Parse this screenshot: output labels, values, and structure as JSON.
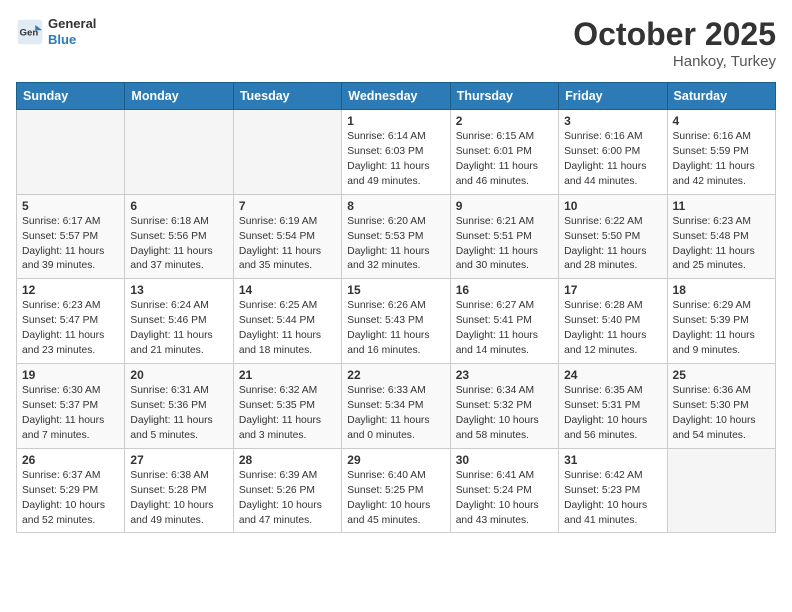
{
  "logo": {
    "line1": "General",
    "line2": "Blue"
  },
  "title": "October 2025",
  "subtitle": "Hankoy, Turkey",
  "weekdays": [
    "Sunday",
    "Monday",
    "Tuesday",
    "Wednesday",
    "Thursday",
    "Friday",
    "Saturday"
  ],
  "weeks": [
    [
      {
        "day": "",
        "info": ""
      },
      {
        "day": "",
        "info": ""
      },
      {
        "day": "",
        "info": ""
      },
      {
        "day": "1",
        "info": "Sunrise: 6:14 AM\nSunset: 6:03 PM\nDaylight: 11 hours\nand 49 minutes."
      },
      {
        "day": "2",
        "info": "Sunrise: 6:15 AM\nSunset: 6:01 PM\nDaylight: 11 hours\nand 46 minutes."
      },
      {
        "day": "3",
        "info": "Sunrise: 6:16 AM\nSunset: 6:00 PM\nDaylight: 11 hours\nand 44 minutes."
      },
      {
        "day": "4",
        "info": "Sunrise: 6:16 AM\nSunset: 5:59 PM\nDaylight: 11 hours\nand 42 minutes."
      }
    ],
    [
      {
        "day": "5",
        "info": "Sunrise: 6:17 AM\nSunset: 5:57 PM\nDaylight: 11 hours\nand 39 minutes."
      },
      {
        "day": "6",
        "info": "Sunrise: 6:18 AM\nSunset: 5:56 PM\nDaylight: 11 hours\nand 37 minutes."
      },
      {
        "day": "7",
        "info": "Sunrise: 6:19 AM\nSunset: 5:54 PM\nDaylight: 11 hours\nand 35 minutes."
      },
      {
        "day": "8",
        "info": "Sunrise: 6:20 AM\nSunset: 5:53 PM\nDaylight: 11 hours\nand 32 minutes."
      },
      {
        "day": "9",
        "info": "Sunrise: 6:21 AM\nSunset: 5:51 PM\nDaylight: 11 hours\nand 30 minutes."
      },
      {
        "day": "10",
        "info": "Sunrise: 6:22 AM\nSunset: 5:50 PM\nDaylight: 11 hours\nand 28 minutes."
      },
      {
        "day": "11",
        "info": "Sunrise: 6:23 AM\nSunset: 5:48 PM\nDaylight: 11 hours\nand 25 minutes."
      }
    ],
    [
      {
        "day": "12",
        "info": "Sunrise: 6:23 AM\nSunset: 5:47 PM\nDaylight: 11 hours\nand 23 minutes."
      },
      {
        "day": "13",
        "info": "Sunrise: 6:24 AM\nSunset: 5:46 PM\nDaylight: 11 hours\nand 21 minutes."
      },
      {
        "day": "14",
        "info": "Sunrise: 6:25 AM\nSunset: 5:44 PM\nDaylight: 11 hours\nand 18 minutes."
      },
      {
        "day": "15",
        "info": "Sunrise: 6:26 AM\nSunset: 5:43 PM\nDaylight: 11 hours\nand 16 minutes."
      },
      {
        "day": "16",
        "info": "Sunrise: 6:27 AM\nSunset: 5:41 PM\nDaylight: 11 hours\nand 14 minutes."
      },
      {
        "day": "17",
        "info": "Sunrise: 6:28 AM\nSunset: 5:40 PM\nDaylight: 11 hours\nand 12 minutes."
      },
      {
        "day": "18",
        "info": "Sunrise: 6:29 AM\nSunset: 5:39 PM\nDaylight: 11 hours\nand 9 minutes."
      }
    ],
    [
      {
        "day": "19",
        "info": "Sunrise: 6:30 AM\nSunset: 5:37 PM\nDaylight: 11 hours\nand 7 minutes."
      },
      {
        "day": "20",
        "info": "Sunrise: 6:31 AM\nSunset: 5:36 PM\nDaylight: 11 hours\nand 5 minutes."
      },
      {
        "day": "21",
        "info": "Sunrise: 6:32 AM\nSunset: 5:35 PM\nDaylight: 11 hours\nand 3 minutes."
      },
      {
        "day": "22",
        "info": "Sunrise: 6:33 AM\nSunset: 5:34 PM\nDaylight: 11 hours\nand 0 minutes."
      },
      {
        "day": "23",
        "info": "Sunrise: 6:34 AM\nSunset: 5:32 PM\nDaylight: 10 hours\nand 58 minutes."
      },
      {
        "day": "24",
        "info": "Sunrise: 6:35 AM\nSunset: 5:31 PM\nDaylight: 10 hours\nand 56 minutes."
      },
      {
        "day": "25",
        "info": "Sunrise: 6:36 AM\nSunset: 5:30 PM\nDaylight: 10 hours\nand 54 minutes."
      }
    ],
    [
      {
        "day": "26",
        "info": "Sunrise: 6:37 AM\nSunset: 5:29 PM\nDaylight: 10 hours\nand 52 minutes."
      },
      {
        "day": "27",
        "info": "Sunrise: 6:38 AM\nSunset: 5:28 PM\nDaylight: 10 hours\nand 49 minutes."
      },
      {
        "day": "28",
        "info": "Sunrise: 6:39 AM\nSunset: 5:26 PM\nDaylight: 10 hours\nand 47 minutes."
      },
      {
        "day": "29",
        "info": "Sunrise: 6:40 AM\nSunset: 5:25 PM\nDaylight: 10 hours\nand 45 minutes."
      },
      {
        "day": "30",
        "info": "Sunrise: 6:41 AM\nSunset: 5:24 PM\nDaylight: 10 hours\nand 43 minutes."
      },
      {
        "day": "31",
        "info": "Sunrise: 6:42 AM\nSunset: 5:23 PM\nDaylight: 10 hours\nand 41 minutes."
      },
      {
        "day": "",
        "info": ""
      }
    ]
  ]
}
